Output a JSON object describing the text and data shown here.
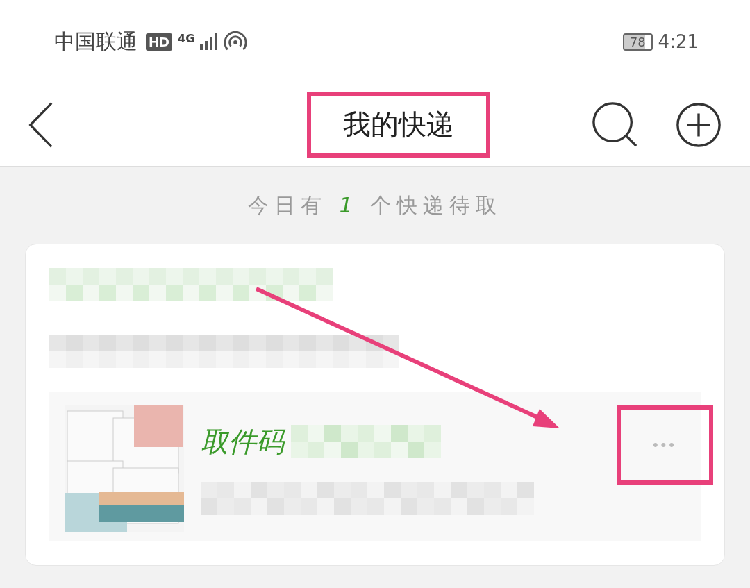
{
  "status_bar": {
    "carrier": "中国联通",
    "hd_badge": "HD",
    "network": "4G",
    "battery": "78",
    "time": "4:21"
  },
  "header": {
    "title": "我的快递"
  },
  "summary": {
    "before": "今日有",
    "count": "1",
    "after": "个快递待取"
  },
  "package": {
    "code_label": "取件码",
    "more": "•••"
  },
  "annotations": {
    "title_highlight": true,
    "more_highlight": true,
    "arrow": true
  }
}
